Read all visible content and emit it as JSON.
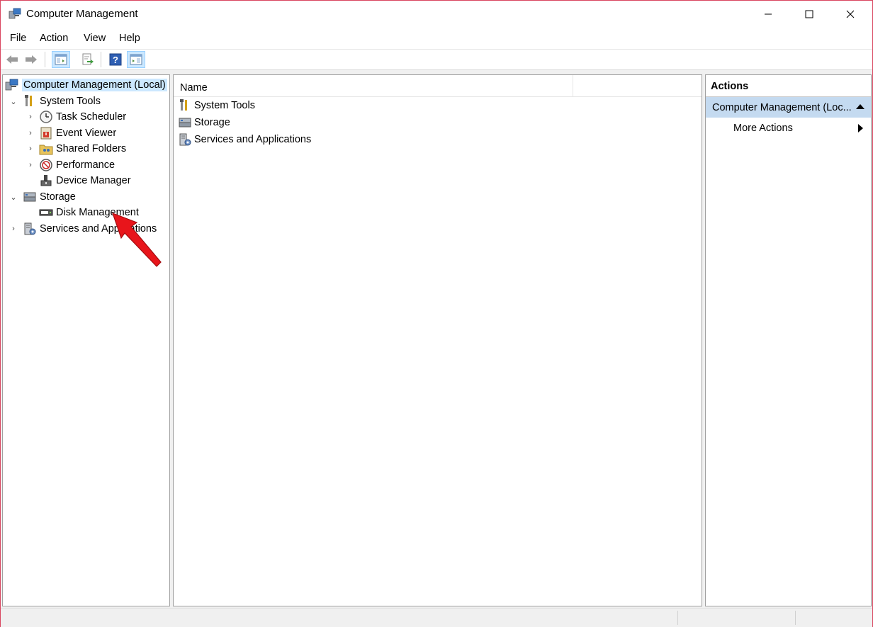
{
  "window": {
    "title": "Computer Management"
  },
  "menu": [
    "File",
    "Action",
    "View",
    "Help"
  ],
  "toolbar": {
    "icons": [
      "back-arrow-icon",
      "forward-arrow-icon",
      "show-hide-tree-icon",
      "export-list-icon",
      "help-icon",
      "show-hide-action-pane-icon"
    ]
  },
  "tree": {
    "root": "Computer Management (Local)",
    "system_tools": "System Tools",
    "task_scheduler": "Task Scheduler",
    "event_viewer": "Event Viewer",
    "shared_folders": "Shared Folders",
    "performance": "Performance",
    "device_manager": "Device Manager",
    "storage": "Storage",
    "disk_management": "Disk Management",
    "services_apps": "Services and Applications"
  },
  "list": {
    "column_name": "Name",
    "rows": [
      "System Tools",
      "Storage",
      "Services and Applications"
    ]
  },
  "actions": {
    "title": "Actions",
    "section": "Computer Management (Loc...",
    "more_actions": "More Actions"
  },
  "colors": {
    "selection": "#cce8ff",
    "action_section": "#c4daf0",
    "annotation_arrow": "#e8151b"
  }
}
